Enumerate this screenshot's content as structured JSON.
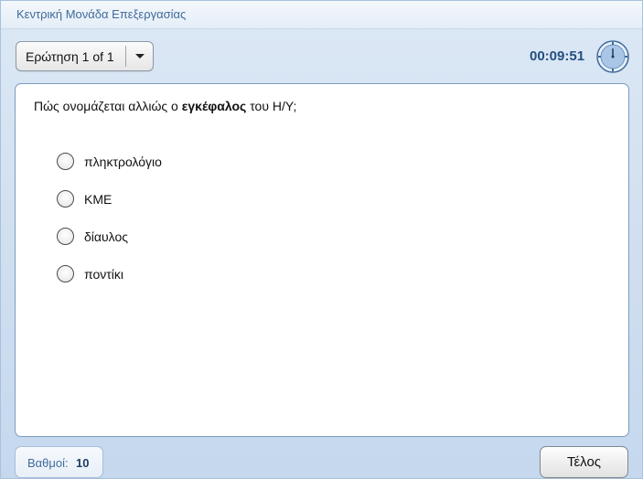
{
  "window": {
    "title": "Κεντρική Μονάδα Επεξεργασίας"
  },
  "toolbar": {
    "question_selector": "Ερώτηση 1 of 1",
    "timer": "00:09:51",
    "timer_icon": "clock-icon"
  },
  "question": {
    "text_before": "Πώς ονομάζεται αλλιώς ο ",
    "text_bold": "εγκέφαλος",
    "text_after": " του Η/Υ;",
    "options": [
      {
        "label": "πληκτρολόγιο",
        "selected": false
      },
      {
        "label": "ΚΜΕ",
        "selected": false
      },
      {
        "label": "δίαυλος",
        "selected": false
      },
      {
        "label": "ποντίκι",
        "selected": false
      }
    ]
  },
  "footer": {
    "score_label": "Βαθμοί:",
    "score_value": "10",
    "finish_button": "Τέλος"
  },
  "colors": {
    "accent": "#3f6b9b",
    "timer": "#244f80",
    "background": "#d3e1f1"
  }
}
